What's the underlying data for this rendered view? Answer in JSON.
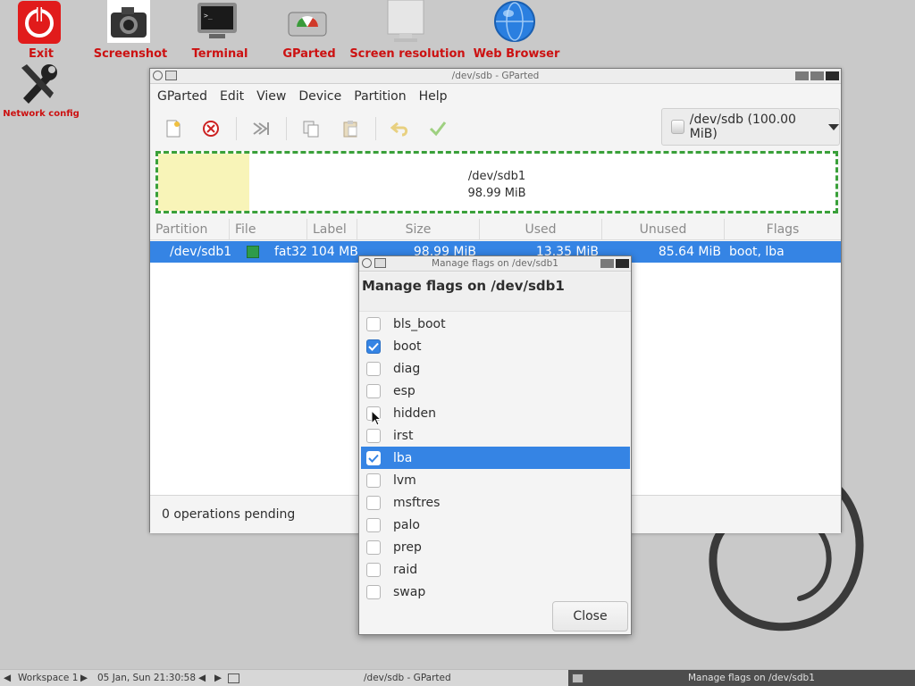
{
  "desktop": {
    "icons": [
      {
        "name": "exit-icon",
        "label": "Exit"
      },
      {
        "name": "screenshot-icon",
        "label": "Screenshot"
      },
      {
        "name": "terminal-icon",
        "label": "Terminal"
      },
      {
        "name": "gparted-icon",
        "label": "GParted"
      },
      {
        "name": "screen-resolution-icon",
        "label": "Screen resolution"
      },
      {
        "name": "web-browser-icon",
        "label": "Web Browser"
      },
      {
        "name": "network-config-icon",
        "label": "Network config"
      }
    ]
  },
  "main_window": {
    "title": "/dev/sdb - GParted",
    "menu": [
      "GParted",
      "Edit",
      "View",
      "Device",
      "Partition",
      "Help"
    ],
    "toolbar": [
      "new-icon",
      "delete-icon",
      "resize-icon",
      "copy-icon",
      "paste-icon",
      "undo-icon",
      "apply-icon"
    ],
    "device_selector": "/dev/sdb (100.00 MiB)",
    "disk_map": {
      "name": "/dev/sdb1",
      "size": "98.99 MiB"
    },
    "columns": [
      "Partition",
      "File System",
      "Label",
      "Size",
      "Used",
      "Unused",
      "Flags"
    ],
    "rows": [
      {
        "partition": "/dev/sdb1",
        "filesystem": "fat32",
        "label": "104 MB",
        "size": "98.99 MiB",
        "used": "13.35 MiB",
        "unused": "85.64 MiB",
        "flags": "boot, lba"
      }
    ],
    "status": "0 operations pending",
    "colors": {
      "accent": "#3584e4",
      "fat32": "#2e9b4a",
      "used_area": "#f8f4b8"
    }
  },
  "dialog": {
    "title": "Manage flags on /dev/sdb1",
    "heading": "Manage flags on /dev/sdb1",
    "flags": [
      {
        "label": "bls_boot",
        "checked": false
      },
      {
        "label": "boot",
        "checked": true
      },
      {
        "label": "diag",
        "checked": false
      },
      {
        "label": "esp",
        "checked": false
      },
      {
        "label": "hidden",
        "checked": false
      },
      {
        "label": "irst",
        "checked": false
      },
      {
        "label": "lba",
        "checked": true,
        "selected": true
      },
      {
        "label": "lvm",
        "checked": false
      },
      {
        "label": "msftres",
        "checked": false
      },
      {
        "label": "palo",
        "checked": false
      },
      {
        "label": "prep",
        "checked": false
      },
      {
        "label": "raid",
        "checked": false
      },
      {
        "label": "swap",
        "checked": false
      }
    ],
    "close_label": "Close"
  },
  "taskbar": {
    "workspace": "Workspace 1",
    "clock": "05 Jan, Sun 21:30:58",
    "tasks": [
      "/dev/sdb - GParted",
      "Manage flags on /dev/sdb1"
    ]
  }
}
